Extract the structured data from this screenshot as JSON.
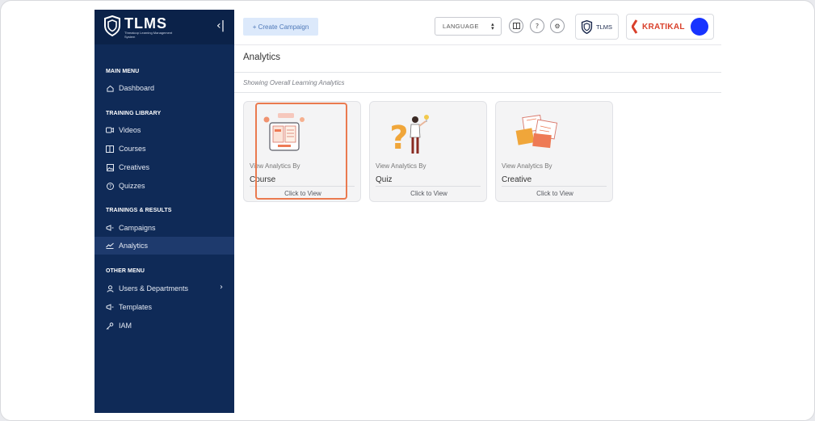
{
  "app": {
    "name": "TLMS",
    "tagline": "Threatcop Learning Management System"
  },
  "sidebar": {
    "collapse_label": "‹|",
    "sections": [
      {
        "label": "MAIN MENU"
      },
      {
        "label": "TRAINING LIBRARY"
      },
      {
        "label": "TRAININGS & RESULTS"
      },
      {
        "label": "OTHER MENU"
      }
    ],
    "items": [
      {
        "label": "Dashboard",
        "icon": "home-icon"
      },
      {
        "label": "Videos",
        "icon": "video-icon"
      },
      {
        "label": "Courses",
        "icon": "book-icon"
      },
      {
        "label": "Creatives",
        "icon": "image-icon"
      },
      {
        "label": "Quizzes",
        "icon": "quiz-icon"
      },
      {
        "label": "Campaigns",
        "icon": "megaphone-icon"
      },
      {
        "label": "Analytics",
        "icon": "chart-icon",
        "active": true
      },
      {
        "label": "Users & Departments",
        "icon": "users-icon"
      },
      {
        "label": "Templates",
        "icon": "template-icon"
      },
      {
        "label": "IAM",
        "icon": "key-icon"
      }
    ]
  },
  "topbar": {
    "create_label": "+ Create Campaign",
    "language_label": "LANGUAGE",
    "org_tlms_label": "TLMS",
    "org_kratikal_label": "KRATIKAL",
    "avatar_color": "#1733ff"
  },
  "main": {
    "title": "Analytics",
    "subtitle": "Showing Overall Learning Analytics",
    "cards": [
      {
        "caption": "View Analytics By",
        "type": "Course",
        "action": "Click to View",
        "illustration": "course-illustration"
      },
      {
        "caption": "View Analytics By",
        "type": "Quiz",
        "action": "Click to View",
        "illustration": "quiz-illustration"
      },
      {
        "caption": "View Analytics By",
        "type": "Creative",
        "action": "Click to View",
        "illustration": "creative-illustration"
      }
    ]
  },
  "colors": {
    "sidebar": "#0f2a57",
    "accent": "#4f79b8",
    "highlight": "#ea7a4f",
    "brand_red": "#d9402b"
  }
}
